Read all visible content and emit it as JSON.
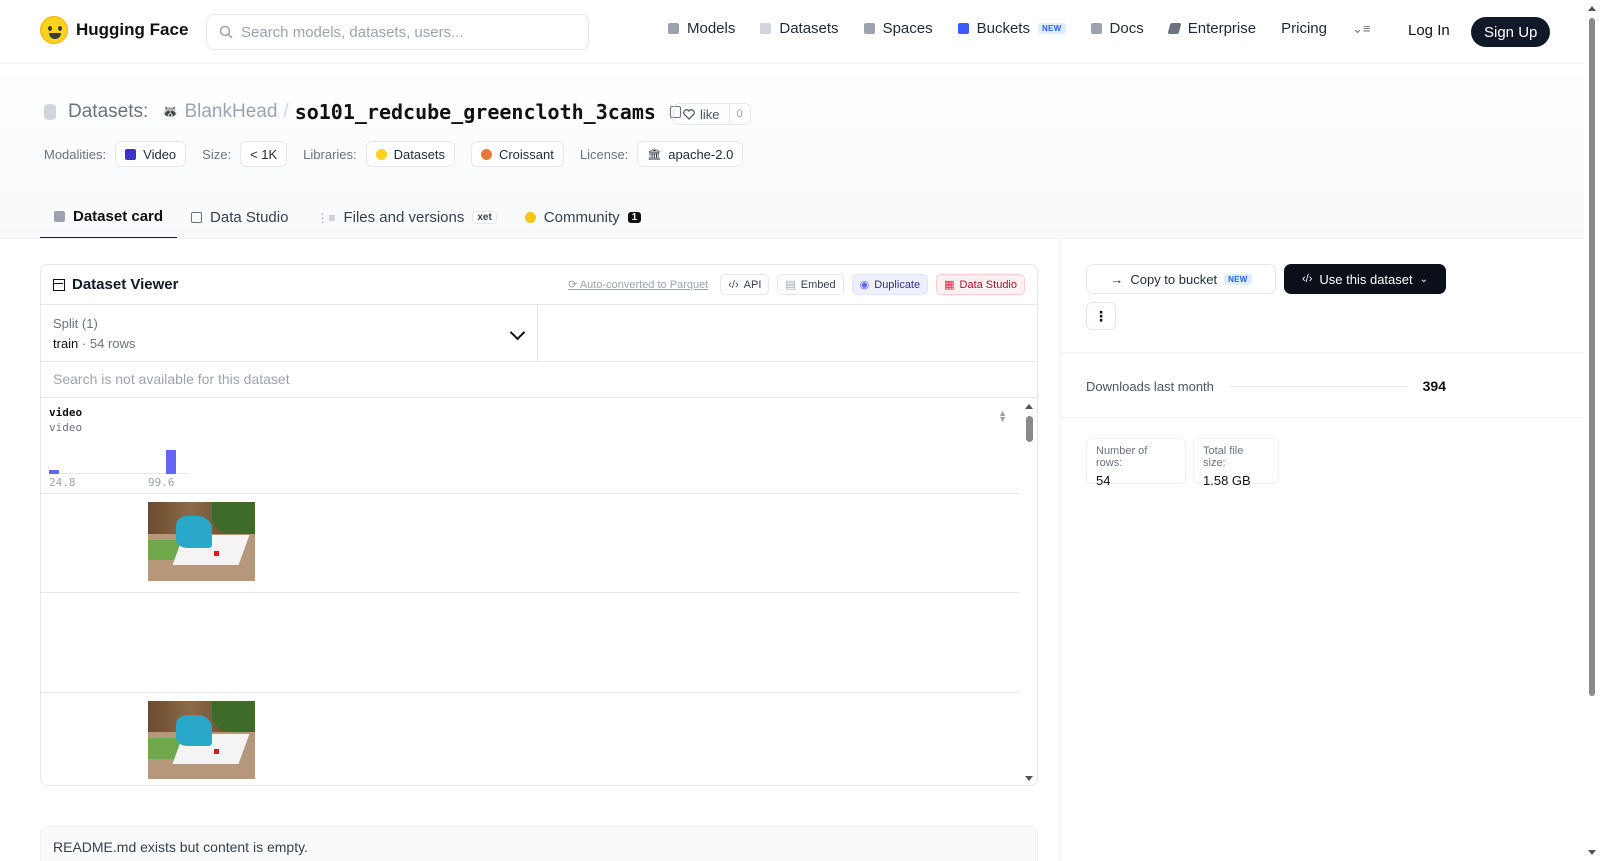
{
  "header": {
    "logo_text": "Hugging Face",
    "search_placeholder": "Search models, datasets, users...",
    "nav": [
      {
        "label": "Models",
        "icon": "cube-icon",
        "color": "#9ca3af"
      },
      {
        "label": "Datasets",
        "icon": "database-icon",
        "color": "#d1d5db"
      },
      {
        "label": "Spaces",
        "icon": "grid-icon",
        "color": "#9ca3af"
      },
      {
        "label": "Buckets",
        "icon": "bucket-icon",
        "color": "#3b5bfd",
        "badge": "NEW"
      },
      {
        "label": "Docs",
        "icon": "book-icon",
        "color": "#9ca3af"
      },
      {
        "label": "Enterprise",
        "icon": "enterprise-icon",
        "color": "#6b7280"
      },
      {
        "label": "Pricing"
      }
    ],
    "login": "Log In",
    "signup": "Sign Up"
  },
  "repo": {
    "type_label": "Datasets:",
    "owner": "BlankHead",
    "separator": "/",
    "name": "so101_redcube_greencloth_3cams",
    "like_label": "like",
    "like_count": "0"
  },
  "meta": {
    "modalities_label": "Modalities:",
    "modality": "Video",
    "size_label": "Size:",
    "size": "< 1K",
    "libraries_label": "Libraries:",
    "libraries": [
      "Datasets",
      "Croissant"
    ],
    "license_label": "License:",
    "license": "apache-2.0"
  },
  "tabs": [
    {
      "label": "Dataset card",
      "active": true
    },
    {
      "label": "Data Studio"
    },
    {
      "label": "Files and versions",
      "badge": "xet"
    },
    {
      "label": "Community",
      "count": "1"
    }
  ],
  "viewer": {
    "title": "Dataset Viewer",
    "auto_converted": "Auto-converted to Parquet",
    "actions": [
      "API",
      "Embed",
      "Duplicate",
      "Data Studio"
    ],
    "split_label": "Split (1)",
    "split_value": "train",
    "split_sep": "·",
    "split_rows": "54 rows",
    "search_disabled": "Search is not available for this dataset",
    "column": {
      "name": "video",
      "dtype": "video",
      "hist_min": "24.8",
      "hist_max": "99.6",
      "hist_bars": [
        0.16,
        0.92
      ]
    }
  },
  "readme_note": "README.md exists but content is empty.",
  "sidebar": {
    "copy_bucket": "Copy to bucket",
    "copy_badge": "NEW",
    "use_dataset": "Use this dataset",
    "more": "⋮",
    "downloads_label": "Downloads last month",
    "downloads_value": "394",
    "rows_label": "Number of rows:",
    "rows_value": "54",
    "size_label": "Total file size:",
    "size_value": "1.58 GB"
  }
}
